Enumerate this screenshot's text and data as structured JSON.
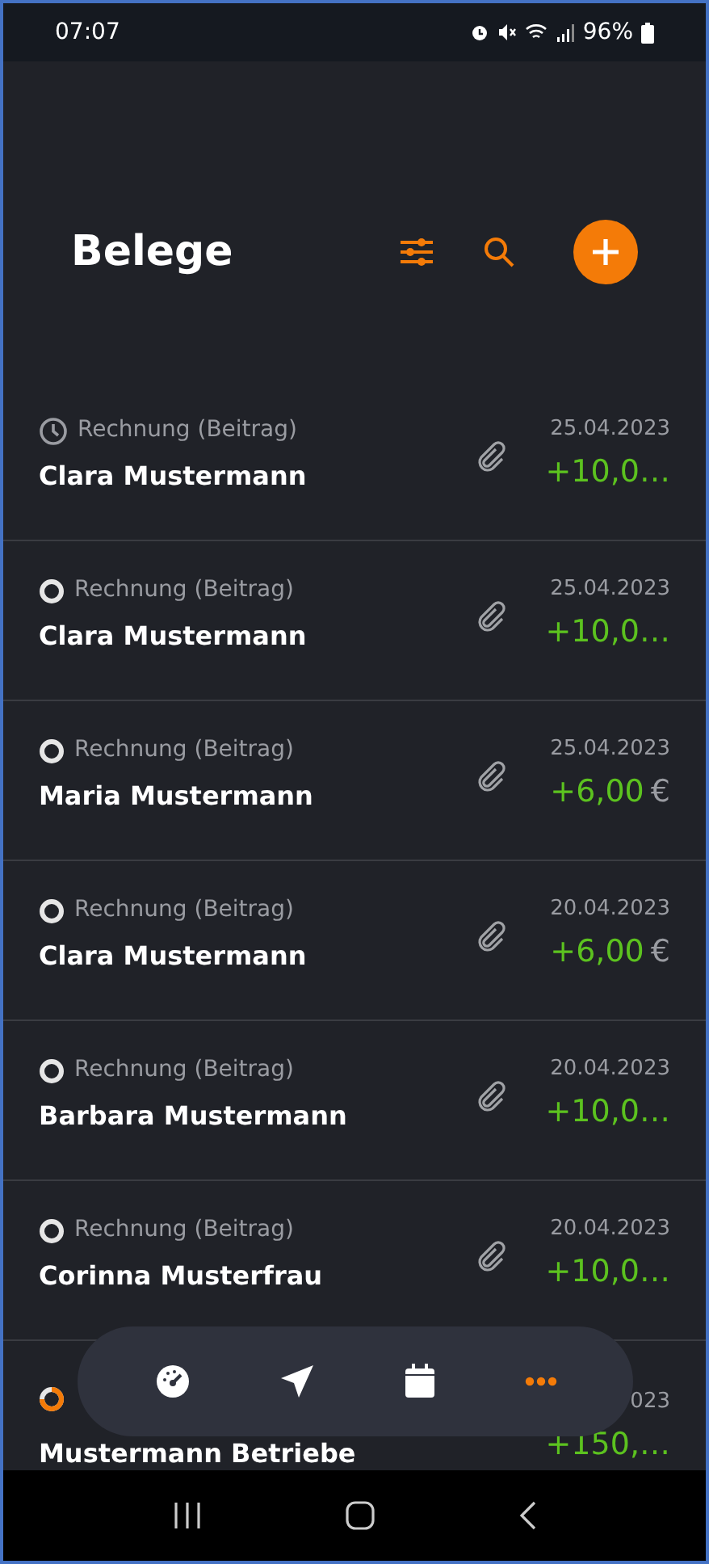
{
  "status_bar": {
    "time": "07:07",
    "battery": "96%"
  },
  "header": {
    "title": "Belege"
  },
  "receipts": [
    {
      "kind": "scheduled",
      "type": "Rechnung (Beitrag)",
      "name": "Clara Mustermann",
      "date": "25.04.2023",
      "amount": "+10,0…",
      "attachment": true
    },
    {
      "kind": "open",
      "type": "Rechnung (Beitrag)",
      "name": "Clara Mustermann",
      "date": "25.04.2023",
      "amount": "+10,0…",
      "attachment": true
    },
    {
      "kind": "open",
      "type": "Rechnung (Beitrag)",
      "name": "Maria Mustermann",
      "date": "25.04.2023",
      "amount": "+6,00",
      "currency": "€",
      "attachment": true
    },
    {
      "kind": "open",
      "type": "Rechnung (Beitrag)",
      "name": "Clara Mustermann",
      "date": "20.04.2023",
      "amount": "+6,00",
      "currency": "€",
      "attachment": true
    },
    {
      "kind": "open",
      "type": "Rechnung (Beitrag)",
      "name": "Barbara Mustermann",
      "date": "20.04.2023",
      "amount": "+10,0…",
      "attachment": true
    },
    {
      "kind": "open",
      "type": "Rechnung (Beitrag)",
      "name": "Corinna Musterfrau",
      "date": "20.04.2023",
      "amount": "+10,0…",
      "attachment": true
    },
    {
      "kind": "partial",
      "name": "Mustermann Betriebe",
      "date": "023",
      "amount": "+150,…"
    }
  ],
  "bottom_nav": [
    {
      "kind": "dashboard",
      "selected": false
    },
    {
      "kind": "send",
      "selected": false
    },
    {
      "kind": "calendar",
      "selected": false
    },
    {
      "kind": "more",
      "selected": true
    }
  ]
}
